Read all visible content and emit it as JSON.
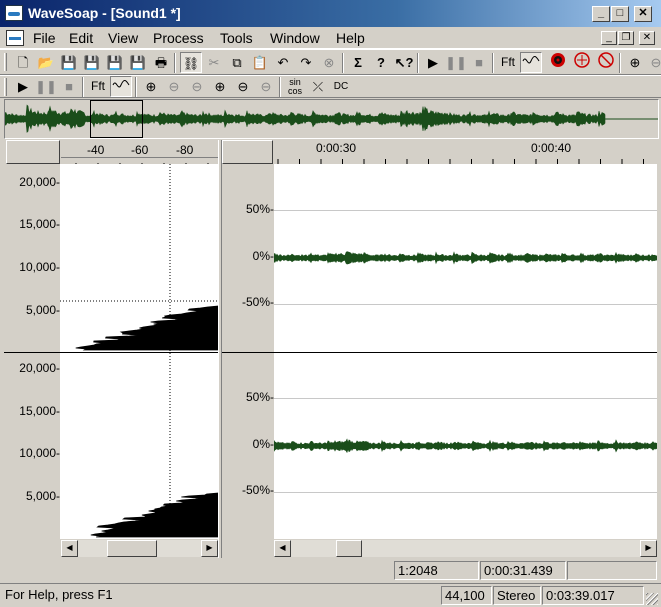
{
  "window": {
    "title": "WaveSoap - [Sound1 *]",
    "minimize": "_",
    "maximize": "□",
    "close": "✕"
  },
  "menu": {
    "items": [
      "File",
      "Edit",
      "View",
      "Process",
      "Tools",
      "Window",
      "Help"
    ],
    "mdi_min": "_",
    "mdi_restore": "❐",
    "mdi_close": "✕"
  },
  "toolbar1": {
    "fft_label": "Fft"
  },
  "toolbar2": {
    "fft_label": "Fft",
    "sincos_label_top": "sin",
    "sincos_label_bottom": "cos",
    "dc_label": "DC"
  },
  "spectrum": {
    "db_ticks": [
      "-40",
      "-60",
      "-80"
    ],
    "freq_ticks": [
      "20,000-",
      "15,000-",
      "10,000-",
      "5,000-"
    ]
  },
  "waveform": {
    "time_ticks": [
      "0:00:30",
      "0:00:40"
    ],
    "percent_ticks": [
      "50%-",
      "0%-",
      "-50%-"
    ],
    "color": "#1a4d1a"
  },
  "status_bar": {
    "zoom": "1:2048",
    "cursor_time": "0:00:31.439",
    "help_text": "For Help, press F1",
    "sample_rate": "44,100",
    "channels": "Stereo",
    "length": "0:03:39.017"
  },
  "colors": {
    "face": "#d4d0c8",
    "title_start": "#0a246a",
    "waveform": "#1a4d1a",
    "spectrum": "#000000"
  }
}
